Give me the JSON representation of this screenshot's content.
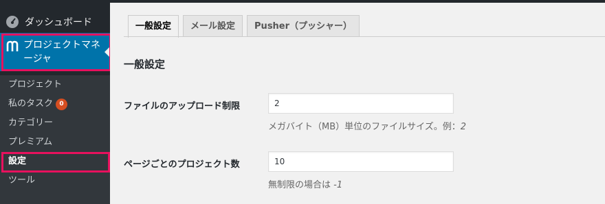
{
  "sidebar": {
    "dashboard_label": "ダッシュボード",
    "plugin_label": "プロジェクトマネージャ",
    "items": [
      {
        "label": "プロジェクト"
      },
      {
        "label": "私のタスク",
        "badge": "0"
      },
      {
        "label": "カテゴリー"
      },
      {
        "label": "プレミアム"
      },
      {
        "label": "設定"
      },
      {
        "label": "ツール"
      }
    ]
  },
  "tabs": [
    "一般設定",
    "メール設定",
    "Pusher（プッシャー）"
  ],
  "section_title": "一般設定",
  "fields": [
    {
      "label": "ファイルのアップロード制限",
      "value": "2",
      "desc": "メガバイト（MB）単位のファイルサイズ。例：",
      "desc_example": "2"
    },
    {
      "label": "ページごとのプロジェクト数",
      "value": "10",
      "desc": "無制限の場合は",
      "desc_example": "-1"
    }
  ],
  "colors": {
    "accent": "#0073aa",
    "highlight": "#e8115e",
    "badge": "#d54e21",
    "sidebar": "#23282d"
  }
}
